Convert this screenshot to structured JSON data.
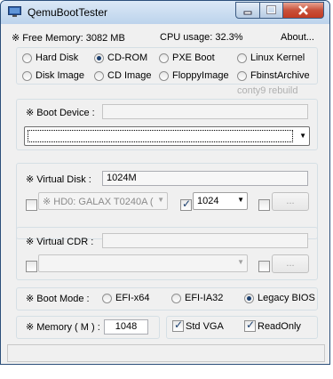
{
  "window": {
    "title": "QemuBootTester"
  },
  "info": {
    "free_memory": "※ Free Memory: 3082 MB",
    "cpu_usage": "CPU usage: 32.3%",
    "about": "About..."
  },
  "boot_sources": [
    {
      "label": "Hard Disk",
      "selected": false
    },
    {
      "label": "CD-ROM",
      "selected": true
    },
    {
      "label": "PXE Boot",
      "selected": false
    },
    {
      "label": "Linux Kernel",
      "selected": false
    },
    {
      "label": "Disk Image",
      "selected": false
    },
    {
      "label": "CD Image",
      "selected": false
    },
    {
      "label": "FloppyImage",
      "selected": false
    },
    {
      "label": "FbinstArchive",
      "selected": false
    }
  ],
  "watermark": "conty9 rebuild",
  "boot_device": {
    "label": "※ Boot Device :",
    "value": "",
    "dropdown_value": ""
  },
  "virtual_disk": {
    "label": "※ Virtual Disk :",
    "size_value": "1024M",
    "disk_select": "※ HD0: GALAX T0240A (",
    "cache_value": "1024",
    "browse": "..."
  },
  "virtual_cdr": {
    "label": "※ Virtual CDR :",
    "value": "",
    "select": "",
    "browse": "..."
  },
  "boot_mode": {
    "label": "※ Boot Mode :",
    "options": [
      {
        "label": "EFI-x64",
        "selected": false
      },
      {
        "label": "EFI-IA32",
        "selected": false
      },
      {
        "label": "Legacy BIOS",
        "selected": true
      }
    ]
  },
  "memory": {
    "label": "※ Memory ( M ) :",
    "value": "1048"
  },
  "std_vga": {
    "label": "Std VGA",
    "checked": true
  },
  "readonly": {
    "label": "ReadOnly",
    "checked": true
  },
  "colors": {
    "titlebar": "#c9dcf1",
    "close": "#c8503a",
    "face": "#f0f0f0"
  }
}
